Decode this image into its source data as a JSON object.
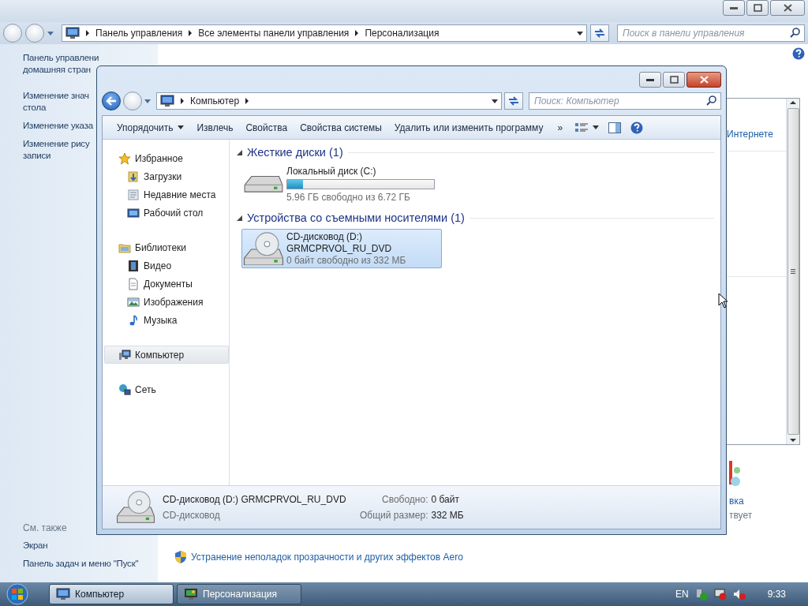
{
  "background_window": {
    "address": {
      "segments": [
        "Панель управления",
        "Все элементы панели управления",
        "Персонализация"
      ]
    },
    "search": {
      "placeholder": "Поиск в панели управления"
    },
    "sidebar": {
      "links": [
        {
          "lines": [
            "Панель управлени",
            "домашняя стран"
          ]
        },
        {
          "lines": [
            "Изменение знач",
            "стола"
          ]
        },
        {
          "lines": [
            "Изменение указа"
          ]
        },
        {
          "lines": [
            "Изменение рису",
            "записи"
          ]
        }
      ],
      "see_also_title": "См. также",
      "see_also": [
        "Экран",
        "Панель задач и меню \"Пуск\""
      ]
    },
    "right_panel": {
      "link": "Интернете",
      "caption": "вка",
      "status": "твует"
    },
    "aero_link": "Устранение неполадок прозрачности и других эффектов Aero"
  },
  "explorer": {
    "address": {
      "segments": [
        "Компьютер"
      ]
    },
    "search": {
      "placeholder": "Поиск: Компьютер"
    },
    "toolbar": [
      {
        "label": "Упорядочить",
        "dropdown": true
      },
      {
        "label": "Извлечь",
        "dropdown": false
      },
      {
        "label": "Свойства",
        "dropdown": false
      },
      {
        "label": "Свойства системы",
        "dropdown": false
      },
      {
        "label": "Удалить или изменить программу",
        "dropdown": false
      }
    ],
    "toolbar_overflow": "»",
    "nav": [
      {
        "label": "Избранное",
        "kind": "star",
        "selected": false,
        "children": [
          {
            "label": "Загрузки",
            "kind": "downloads",
            "selected": false
          },
          {
            "label": "Недавние места",
            "kind": "recent",
            "selected": false
          },
          {
            "label": "Рабочий стол",
            "kind": "desktop",
            "selected": false
          }
        ]
      },
      {
        "label": "Библиотеки",
        "kind": "library",
        "selected": false,
        "children": [
          {
            "label": "Видео",
            "kind": "video",
            "selected": false
          },
          {
            "label": "Документы",
            "kind": "documents",
            "selected": false
          },
          {
            "label": "Изображения",
            "kind": "pictures",
            "selected": false
          },
          {
            "label": "Музыка",
            "kind": "music",
            "selected": false
          }
        ]
      },
      {
        "label": "Компьютер",
        "kind": "computer",
        "selected": true
      },
      {
        "label": "Сеть",
        "kind": "network",
        "selected": false
      }
    ],
    "groups": [
      {
        "title": "Жесткие диски (1)",
        "expanded": true,
        "items": [
          {
            "kind": "hdd",
            "name": "Локальный диск (C:)",
            "level": 0.11,
            "info": "5.96 ГБ свободно из 6.72 ГБ",
            "selected": false
          }
        ]
      },
      {
        "title": "Устройства со съемными носителями (1)",
        "expanded": true,
        "items": [
          {
            "kind": "cd",
            "name": "CD-дисковод (D:)",
            "label": "GRMCPRVOL_RU_DVD",
            "info": "0 байт свободно из 332 МБ",
            "selected": true
          }
        ]
      }
    ],
    "details": {
      "title": "CD-дисковод (D:) GRMCPRVOL_RU_DVD",
      "subtitle": "CD-дисковод",
      "fields": [
        {
          "label": "Свободно:",
          "value": "0 байт"
        },
        {
          "label": "Общий размер:",
          "value": "332 МБ"
        }
      ]
    }
  },
  "taskbar": {
    "items": [
      {
        "label": "Компьютер",
        "kind": "computer",
        "selected": true
      },
      {
        "label": "Персонализация",
        "kind": "personalize",
        "selected": false
      }
    ],
    "language": "EN",
    "clock": "9:33"
  }
}
